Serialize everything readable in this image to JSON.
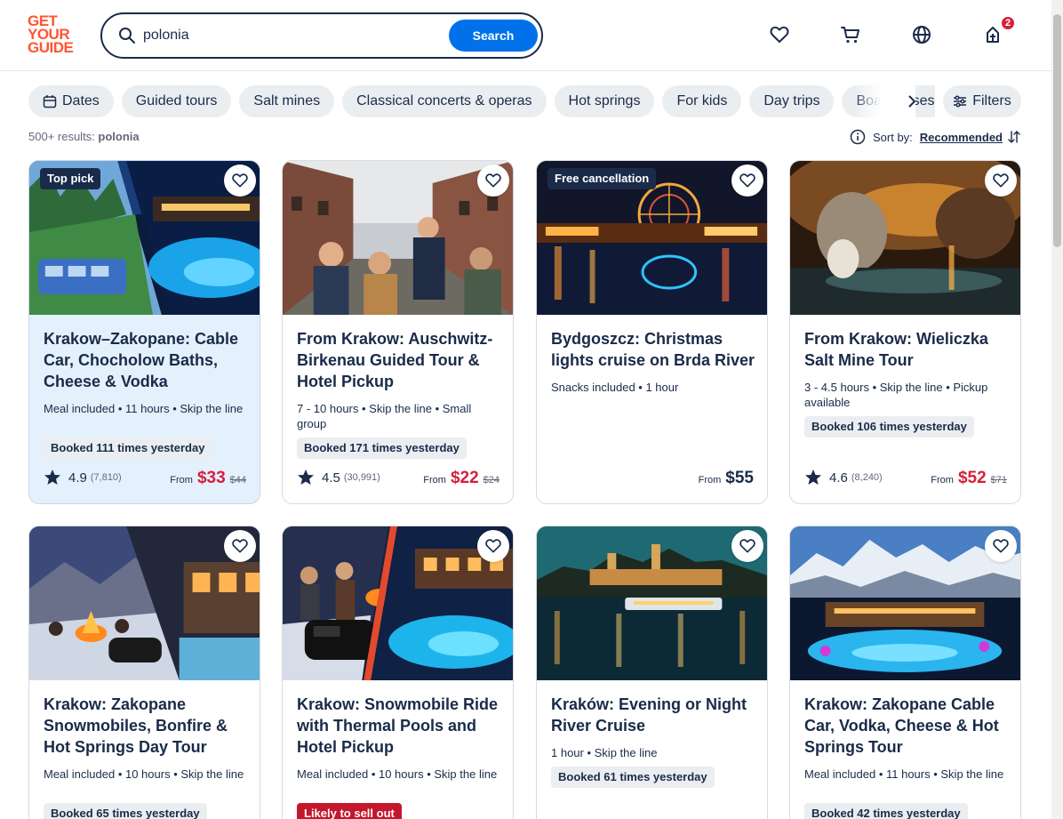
{
  "brand": {
    "logo_lines": [
      "GET",
      "YOUR",
      "GUIDE"
    ],
    "color": "#ff5533"
  },
  "search": {
    "value": "polonia",
    "button_label": "Search"
  },
  "header": {
    "cart_badge": "2"
  },
  "chips": {
    "dates_label": "Dates",
    "items": [
      "Guided tours",
      "Salt mines",
      "Classical concerts & operas",
      "Hot springs",
      "For kids",
      "Day trips",
      "Boat cruises"
    ],
    "filters_label": "Filters"
  },
  "results": {
    "count_label": "500+ results:",
    "query": "polonia"
  },
  "sort": {
    "label": "Sort by:",
    "value": "Recommended"
  },
  "colors": {
    "accent": "#0071eb",
    "sale": "#d6203b",
    "text": "#1a2b49"
  },
  "cards": [
    {
      "tag": "Top pick",
      "title": "Krakow–Zakopane: Cable Car, Chocholow Baths, Cheese & Vodka",
      "meta": "Meal included • 11 hours • Skip the line",
      "booked": "Booked 111 times yesterday",
      "rating": "4.9",
      "reviews": "(7,810)",
      "from": "From",
      "price": "$33",
      "old_price": "$44"
    },
    {
      "tag": "",
      "title": "From Krakow: Auschwitz-Birkenau Guided Tour & Hotel Pickup",
      "meta": "7 - 10 hours • Skip the line • Small group",
      "booked": "Booked 171 times yesterday",
      "rating": "4.5",
      "reviews": "(30,991)",
      "from": "From",
      "price": "$22",
      "old_price": "$24"
    },
    {
      "tag": "Free cancellation",
      "title": "Bydgoszcz: Christmas lights cruise on Brda River",
      "meta": "Snacks included • 1 hour",
      "booked": "",
      "rating": "",
      "reviews": "",
      "from": "From",
      "price": "$55",
      "old_price": ""
    },
    {
      "tag": "",
      "title": "From Krakow: Wieliczka Salt Mine Tour",
      "meta": "3 - 4.5 hours • Skip the line • Pickup available",
      "booked": "Booked 106 times yesterday",
      "rating": "4.6",
      "reviews": "(8,240)",
      "from": "From",
      "price": "$52",
      "old_price": "$71"
    },
    {
      "tag": "",
      "title": "Krakow: Zakopane Snowmobiles, Bonfire & Hot Springs Day Tour",
      "meta": "Meal included • 10 hours • Skip the line",
      "booked": "Booked 65 times yesterday"
    },
    {
      "tag": "",
      "title": "Krakow: Snowmobile Ride with Thermal Pools and Hotel Pickup",
      "meta": "Meal included • 10 hours • Skip the line",
      "badge": "Likely to sell out"
    },
    {
      "tag": "",
      "title": "Kraków: Evening or Night River Cruise",
      "meta": "1 hour • Skip the line",
      "booked": "Booked 61 times yesterday"
    },
    {
      "tag": "",
      "title": "Krakow: Zakopane Cable Car, Vodka, Cheese & Hot Springs Tour",
      "meta": "Meal included • 11 hours • Skip the line",
      "booked": "Booked 42 times yesterday"
    }
  ]
}
